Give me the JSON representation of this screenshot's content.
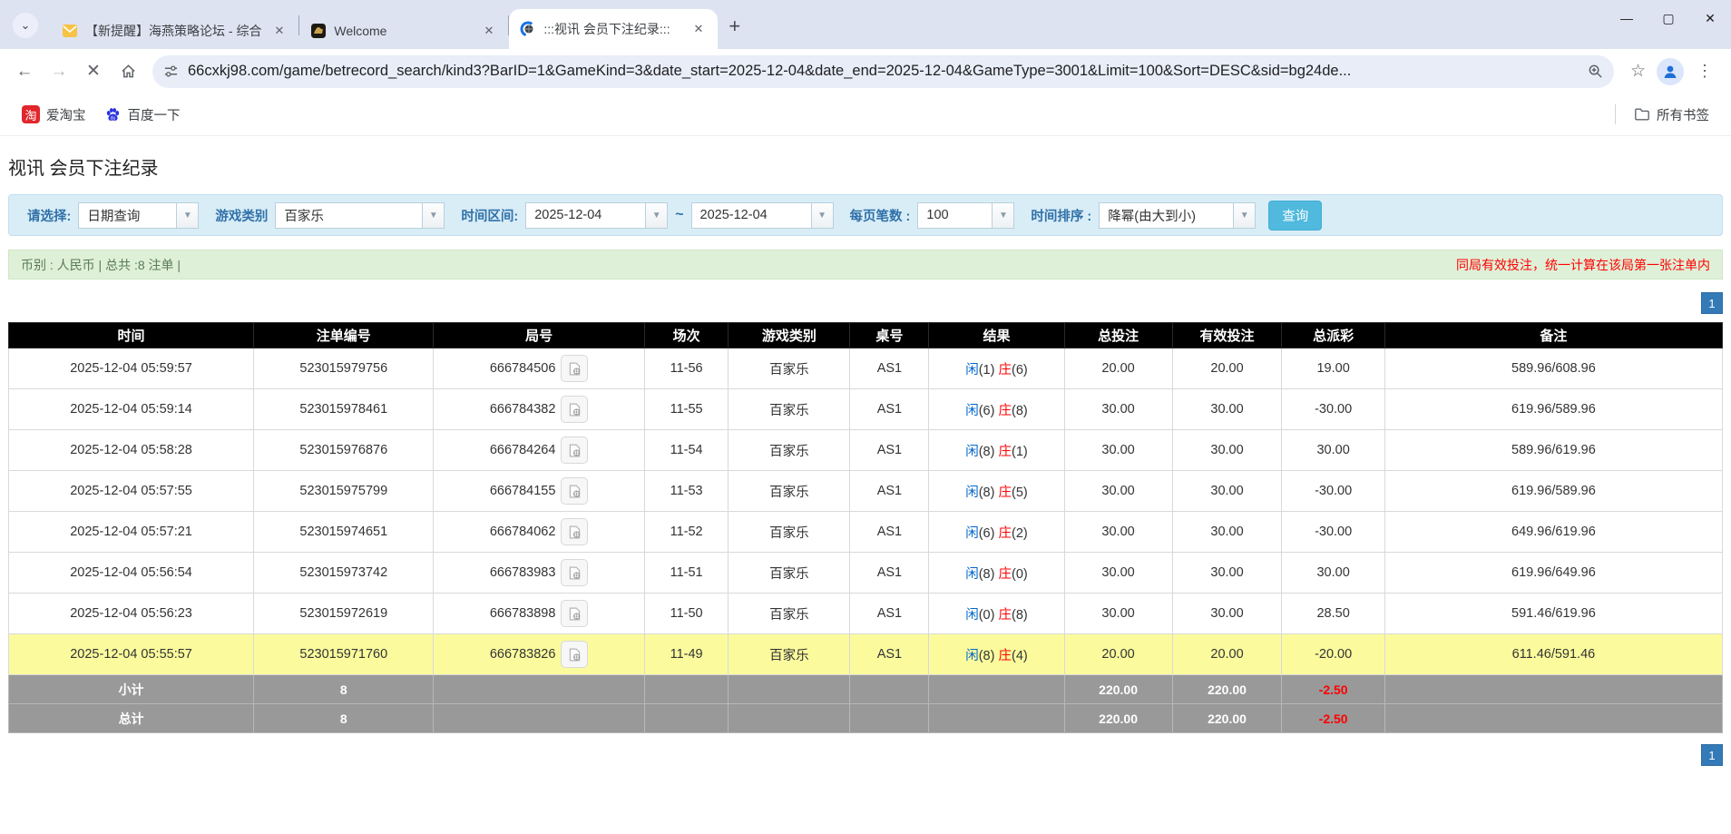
{
  "browser": {
    "tabs": [
      {
        "title": "【新提醒】海燕策略论坛 - 综合",
        "active": false
      },
      {
        "title": "Welcome",
        "active": false
      },
      {
        "title": ":::视讯 会员下注纪录:::",
        "active": true
      }
    ],
    "new_tab_glyph": "+",
    "tab_search_glyph": "⌄",
    "close_glyph": "✕",
    "window": {
      "minimize": "—",
      "maximize": "▢",
      "close": "✕"
    },
    "nav": {
      "back": "←",
      "forward": "→",
      "stop": "✕",
      "menu": "⋮",
      "star": "☆"
    },
    "url": "66cxkj98.com/game/betrecord_search/kind3?BarID=1&GameKind=3&date_start=2025-12-04&date_end=2025-12-04&GameType=3001&Limit=100&Sort=DESC&sid=bg24de...",
    "bookmarks": {
      "taobao_glyph": "淘",
      "taobao": "爱淘宝",
      "baidu": "百度一下",
      "all_bookmarks": "所有书签"
    }
  },
  "page": {
    "title": "视讯 会员下注纪录",
    "filters": {
      "select_label": "请选择:",
      "select_value": "日期查询",
      "game_kind_label": "游戏类别",
      "game_kind_value": "百家乐",
      "date_range_label": "时间区间:",
      "date_start": "2025-12-04",
      "tilde": "~",
      "date_end": "2025-12-04",
      "page_size_label": "每页笔数 :",
      "page_size_value": "100",
      "sort_label": "时间排序 :",
      "sort_value": "降幂(由大到小)",
      "search_button": "查询",
      "arrow_glyph": "▼"
    },
    "summary": {
      "left": "币别 : 人民币 | 总共 :8 注单 |",
      "right": "同局有效投注，统一计算在该局第一张注单内"
    },
    "pagination": "1",
    "table": {
      "headers": [
        "时间",
        "注单编号",
        "局号",
        "场次",
        "游戏类别",
        "桌号",
        "结果",
        "总投注",
        "有效投注",
        "总派彩",
        "备注"
      ],
      "rows": [
        {
          "time": "2025-12-04 05:59:57",
          "bet_id": "523015979756",
          "round_id": "666784506",
          "session": "11-56",
          "game": "百家乐",
          "table_no": "AS1",
          "res_p": "闲",
          "res_pn": "(1)",
          "res_b": "庄",
          "res_bn": "(6)",
          "total_bet": "20.00",
          "valid_bet": "20.00",
          "payout": "19.00",
          "note": "589.96/608.96",
          "highlight": false
        },
        {
          "time": "2025-12-04 05:59:14",
          "bet_id": "523015978461",
          "round_id": "666784382",
          "session": "11-55",
          "game": "百家乐",
          "table_no": "AS1",
          "res_p": "闲",
          "res_pn": "(6)",
          "res_b": "庄",
          "res_bn": "(8)",
          "total_bet": "30.00",
          "valid_bet": "30.00",
          "payout": "-30.00",
          "note": "619.96/589.96",
          "highlight": false
        },
        {
          "time": "2025-12-04 05:58:28",
          "bet_id": "523015976876",
          "round_id": "666784264",
          "session": "11-54",
          "game": "百家乐",
          "table_no": "AS1",
          "res_p": "闲",
          "res_pn": "(8)",
          "res_b": "庄",
          "res_bn": "(1)",
          "total_bet": "30.00",
          "valid_bet": "30.00",
          "payout": "30.00",
          "note": "589.96/619.96",
          "highlight": false
        },
        {
          "time": "2025-12-04 05:57:55",
          "bet_id": "523015975799",
          "round_id": "666784155",
          "session": "11-53",
          "game": "百家乐",
          "table_no": "AS1",
          "res_p": "闲",
          "res_pn": "(8)",
          "res_b": "庄",
          "res_bn": "(5)",
          "total_bet": "30.00",
          "valid_bet": "30.00",
          "payout": "-30.00",
          "note": "619.96/589.96",
          "highlight": false
        },
        {
          "time": "2025-12-04 05:57:21",
          "bet_id": "523015974651",
          "round_id": "666784062",
          "session": "11-52",
          "game": "百家乐",
          "table_no": "AS1",
          "res_p": "闲",
          "res_pn": "(6)",
          "res_b": "庄",
          "res_bn": "(2)",
          "total_bet": "30.00",
          "valid_bet": "30.00",
          "payout": "-30.00",
          "note": "649.96/619.96",
          "highlight": false
        },
        {
          "time": "2025-12-04 05:56:54",
          "bet_id": "523015973742",
          "round_id": "666783983",
          "session": "11-51",
          "game": "百家乐",
          "table_no": "AS1",
          "res_p": "闲",
          "res_pn": "(8)",
          "res_b": "庄",
          "res_bn": "(0)",
          "total_bet": "30.00",
          "valid_bet": "30.00",
          "payout": "30.00",
          "note": "619.96/649.96",
          "highlight": false
        },
        {
          "time": "2025-12-04 05:56:23",
          "bet_id": "523015972619",
          "round_id": "666783898",
          "session": "11-50",
          "game": "百家乐",
          "table_no": "AS1",
          "res_p": "闲",
          "res_pn": "(0)",
          "res_b": "庄",
          "res_bn": "(8)",
          "total_bet": "30.00",
          "valid_bet": "30.00",
          "payout": "28.50",
          "note": "591.46/619.96",
          "highlight": false
        },
        {
          "time": "2025-12-04 05:55:57",
          "bet_id": "523015971760",
          "round_id": "666783826",
          "session": "11-49",
          "game": "百家乐",
          "table_no": "AS1",
          "res_p": "闲",
          "res_pn": "(8)",
          "res_b": "庄",
          "res_bn": "(4)",
          "total_bet": "20.00",
          "valid_bet": "20.00",
          "payout": "-20.00",
          "note": "611.46/591.46",
          "highlight": true
        }
      ],
      "subtotal": {
        "label": "小计",
        "count": "8",
        "total_bet": "220.00",
        "valid_bet": "220.00",
        "payout": "-2.50"
      },
      "total": {
        "label": "总计",
        "count": "8",
        "total_bet": "220.00",
        "valid_bet": "220.00",
        "payout": "-2.50"
      }
    }
  }
}
